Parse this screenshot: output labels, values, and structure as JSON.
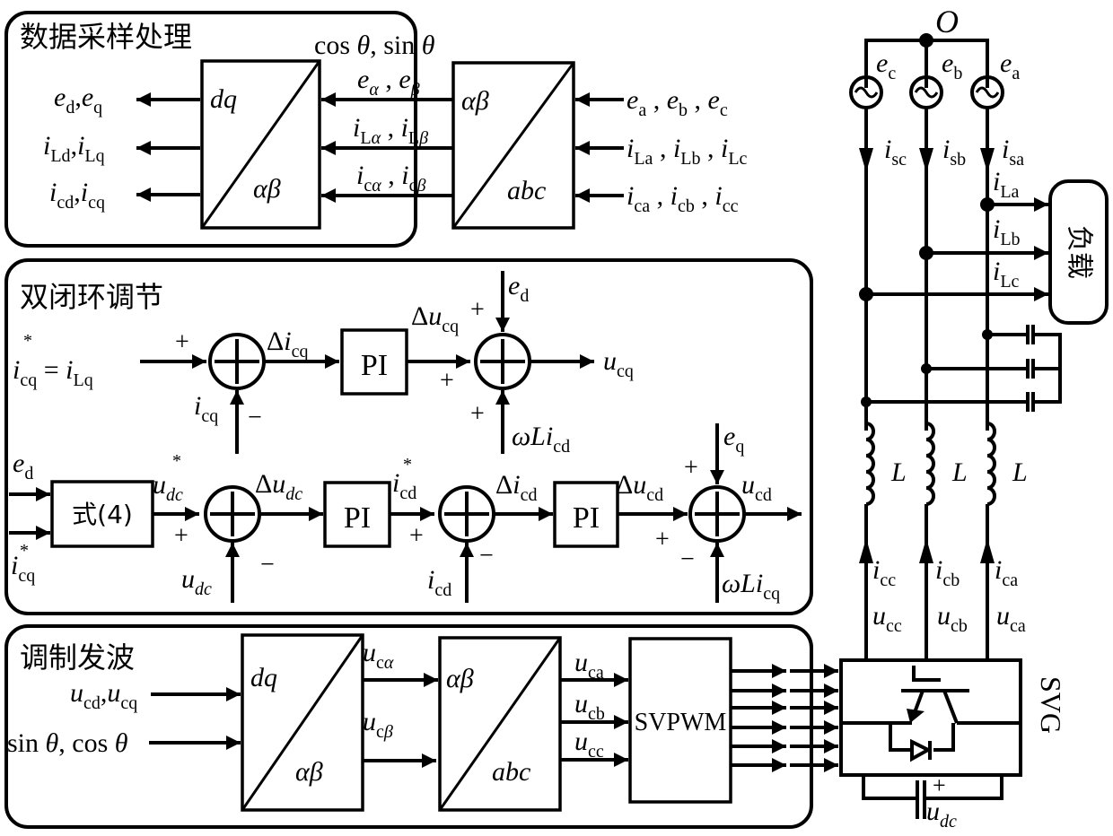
{
  "panels": {
    "sampling": {
      "title": "数据采样处理",
      "angle_input": "cos θ, sin θ",
      "block_park": {
        "top": "dq",
        "bottom": "αβ"
      },
      "block_clarke": {
        "top": "αβ",
        "bottom": "abc"
      },
      "inputs": [
        "e_a, e_b, e_c",
        "i_La, i_Lb, i_Lc",
        "i_ca, i_cb, i_cc"
      ],
      "intermediate": [
        "e_α, e_β",
        "i_Lα, i_Lβ",
        "i_cα, i_cβ"
      ],
      "outputs": [
        "e_d, e_q",
        "i_Ld, i_Lq",
        "i_cd, i_cq"
      ]
    },
    "double_loop": {
      "title": "双闭环调节",
      "pi_label": "PI",
      "eq4_label": "式(4)",
      "q_loop": {
        "reference": "i*_cq = i_Lq",
        "feedback": "i_cq",
        "error": "Δi_cq",
        "pi_out": "Δu_cq",
        "feedforward_top": "e_d",
        "feedforward_bottom": "ωL i_cd",
        "output": "u_cq",
        "signs": [
          "+",
          "−",
          "+",
          "+",
          "+"
        ]
      },
      "d_loop": {
        "inputs": [
          "e_d",
          "i*_cq"
        ],
        "voltage_ref": "u*_dc",
        "voltage_feedback": "u_dc",
        "voltage_error": "Δu_dc",
        "current_ref": "i*_cd",
        "current_feedback": "i_cd",
        "current_error": "Δi_cd",
        "pi_out": "Δu_cd",
        "feedforward_top": "e_q",
        "feedforward_bottom": "ωL i_cq",
        "output": "u_cd",
        "signs": [
          "+",
          "−",
          "+",
          "−",
          "+",
          "+",
          "−"
        ]
      }
    },
    "modulation": {
      "title": "调制发波",
      "inputs": [
        "u_cd, u_cq",
        "sin θ, cos θ"
      ],
      "block_park_inv": {
        "top": "dq",
        "bottom": "αβ"
      },
      "block_clarke_inv": {
        "top": "αβ",
        "bottom": "abc"
      },
      "alpha_beta": [
        "u_cα",
        "u_cβ"
      ],
      "abc": [
        "u_ca",
        "u_cb",
        "u_cc"
      ],
      "svpwm_label": "SVPWM",
      "pwm_signal_count": 6
    }
  },
  "circuit": {
    "neutral": "O",
    "sources": [
      "e_c",
      "e_b",
      "e_a"
    ],
    "source_currents": [
      "i_sc",
      "i_sb",
      "i_sa"
    ],
    "load_currents": [
      "i_La",
      "i_Lb",
      "i_Lc"
    ],
    "load_label": "负载",
    "inductor_label": "L",
    "converter_currents": [
      "i_cc",
      "i_cb",
      "i_ca"
    ],
    "converter_voltages": [
      "u_cc",
      "u_cb",
      "u_ca"
    ],
    "converter_label": "SVG",
    "dc_label": "u_dc",
    "dc_sign": "+"
  }
}
